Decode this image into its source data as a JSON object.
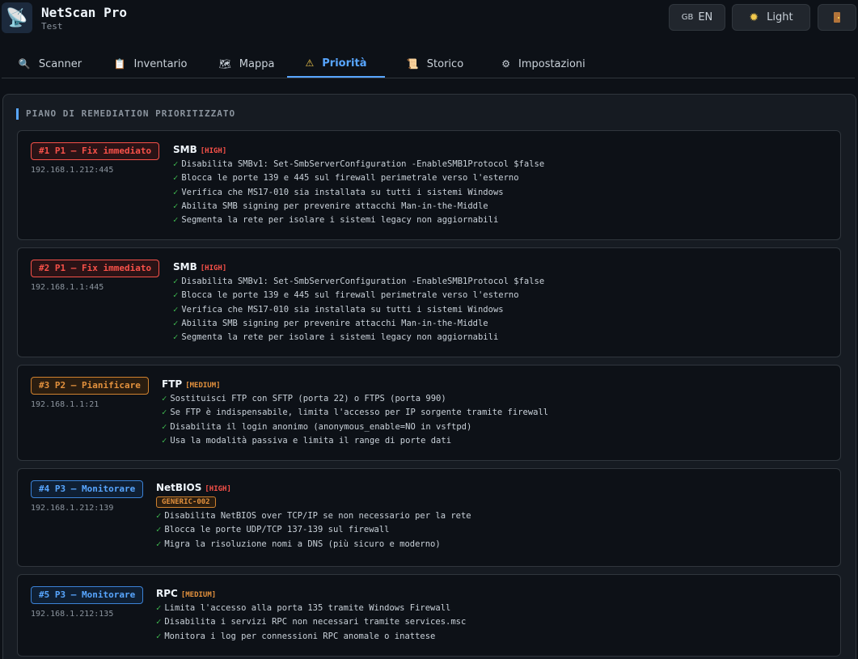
{
  "app": {
    "title": "NetScan Pro",
    "subtitle": "Test",
    "logo_icon": "satellite-dish-icon"
  },
  "header": {
    "lang_flag": "GB",
    "lang_label": "EN",
    "theme_label": "Light",
    "theme_icon": "sun-icon",
    "exit_icon": "door-icon"
  },
  "tabs": [
    {
      "label": "Scanner",
      "icon": "magnifier-icon",
      "active": false
    },
    {
      "label": "Inventario",
      "icon": "clipboard-icon",
      "active": false
    },
    {
      "label": "Mappa",
      "icon": "map-icon",
      "active": false
    },
    {
      "label": "Priorità",
      "icon": "warning-icon",
      "active": true
    },
    {
      "label": "Storico",
      "icon": "scroll-icon",
      "active": false
    },
    {
      "label": "Impostazioni",
      "icon": "gear-icon",
      "active": false
    }
  ],
  "section_title": "PIANO DI REMEDIATION PRIORITIZZATO",
  "items": [
    {
      "badge": "#1 P1 — Fix immediato",
      "priority": "p1",
      "ip": "192.168.1.212:445",
      "service": "SMB",
      "severity": "[HIGH]",
      "severity_class": "high",
      "tag": "",
      "steps": [
        "Disabilita SMBv1: Set-SmbServerConfiguration -EnableSMB1Protocol $false",
        "Blocca le porte 139 e 445 sul firewall perimetrale verso l'esterno",
        "Verifica che MS17-010 sia installata su tutti i sistemi Windows",
        "Abilita SMB signing per prevenire attacchi Man-in-the-Middle",
        "Segmenta la rete per isolare i sistemi legacy non aggiornabili"
      ]
    },
    {
      "badge": "#2 P1 — Fix immediato",
      "priority": "p1",
      "ip": "192.168.1.1:445",
      "service": "SMB",
      "severity": "[HIGH]",
      "severity_class": "high",
      "tag": "",
      "steps": [
        "Disabilita SMBv1: Set-SmbServerConfiguration -EnableSMB1Protocol $false",
        "Blocca le porte 139 e 445 sul firewall perimetrale verso l'esterno",
        "Verifica che MS17-010 sia installata su tutti i sistemi Windows",
        "Abilita SMB signing per prevenire attacchi Man-in-the-Middle",
        "Segmenta la rete per isolare i sistemi legacy non aggiornabili"
      ]
    },
    {
      "badge": "#3 P2 — Pianificare",
      "priority": "p2",
      "ip": "192.168.1.1:21",
      "service": "FTP",
      "severity": "[MEDIUM]",
      "severity_class": "medium",
      "tag": "",
      "steps": [
        "Sostituisci FTP con SFTP (porta 22) o FTPS (porta 990)",
        "Se FTP è indispensabile, limita l'accesso per IP sorgente tramite firewall",
        "Disabilita il login anonimo (anonymous_enable=NO in vsftpd)",
        "Usa la modalità passiva e limita il range di porte dati"
      ]
    },
    {
      "badge": "#4 P3 — Monitorare",
      "priority": "p3",
      "ip": "192.168.1.212:139",
      "service": "NetBIOS",
      "severity": "[HIGH]",
      "severity_class": "high",
      "tag": "GENERIC-002",
      "steps": [
        "Disabilita NetBIOS over TCP/IP se non necessario per la rete",
        "Blocca le porte UDP/TCP 137-139 sul firewall",
        "Migra la risoluzione nomi a DNS (più sicuro e moderno)"
      ]
    },
    {
      "badge": "#5 P3 — Monitorare",
      "priority": "p3",
      "ip": "192.168.1.212:135",
      "service": "RPC",
      "severity": "[MEDIUM]",
      "severity_class": "medium",
      "tag": "",
      "steps": [
        "Limita l'accesso alla porta 135 tramite Windows Firewall",
        "Disabilita i servizi RPC non necessari tramite services.msc",
        "Monitora i log per connessioni RPC anomale o inattese"
      ]
    }
  ]
}
